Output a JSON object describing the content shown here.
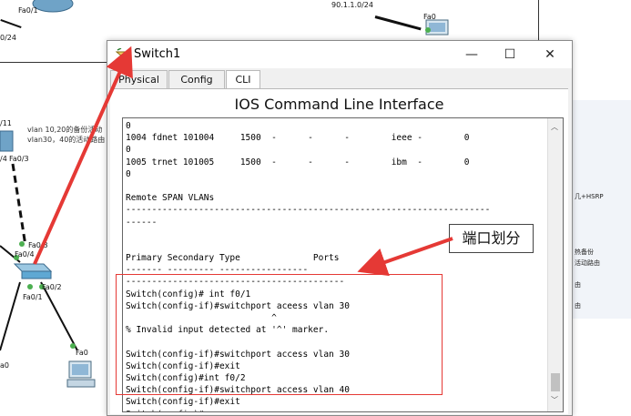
{
  "topology": {
    "label_fa01_top": "Fa0/1",
    "label_subnet_left": "0/24",
    "label_subnet_right": "90.1.1.0/24",
    "label_fa0_right": "Fa0",
    "label_11": "/11",
    "label_fa4": "/4",
    "label_fa03_a": "Fa0/3",
    "note_line1": "vlan 10,20的备份活动",
    "note_line2": "vlan30，40的活动路由",
    "label_fa03_b": "Fa0/3",
    "label_fa04": "Fa0/4",
    "label_fa02": "Fa0/2",
    "label_fa01": "Fa0/1",
    "label_fa0_pc": "Fa0",
    "label_a0": "a0"
  },
  "right_panel": {
    "item1": "几+HSRP",
    "item2": "热备份",
    "item3": "活动路由",
    "item4": "由",
    "item5": "由"
  },
  "window": {
    "title": "Switch1",
    "minimize": "—",
    "maximize": "☐",
    "close": "✕"
  },
  "tabs": [
    {
      "label": "Physical"
    },
    {
      "label": "Config"
    },
    {
      "label": "CLI"
    }
  ],
  "cli": {
    "header": "IOS Command Line Interface",
    "lines": [
      "0",
      "1004 fdnet 101004     1500  -      -      -        ieee -        0",
      "0",
      "1005 trnet 101005     1500  -      -      -        ibm  -        0",
      "0",
      "",
      "Remote SPAN VLANs",
      "----------------------------------------------------------------------",
      "------",
      "",
      "",
      "Primary Secondary Type              Ports",
      "------- --------- -----------------",
      "------------------------------------------",
      "Switch(config)# int f0/1",
      "Switch(config-if)#switchport aceess vlan 30",
      "                            ^",
      "% Invalid input detected at '^' marker.",
      "",
      "Switch(config-if)#switchport access vlan 30",
      "Switch(config-if)#exit",
      "Switch(config)#int f0/2",
      "Switch(config-if)#switchport access vlan 40",
      "Switch(config-if)#exit",
      "Switch(config)#"
    ]
  },
  "annotation": {
    "callout": "端口划分"
  },
  "colors": {
    "annotation_red": "#e53935",
    "link_black": "#111111",
    "switch_blue": "#5fa8d3"
  }
}
